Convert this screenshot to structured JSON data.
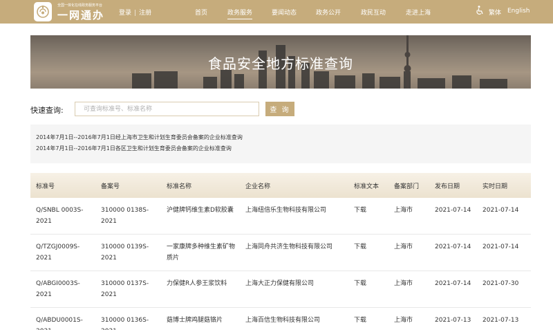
{
  "header": {
    "logo_small_text": "全国一体化在线政务服务平台",
    "logo_text": "一网通办",
    "login": "登录",
    "separator": "|",
    "register": "注册",
    "nav": [
      {
        "label": "首页",
        "active": false
      },
      {
        "label": "政务服务",
        "active": true
      },
      {
        "label": "要闻动态",
        "active": false
      },
      {
        "label": "政务公开",
        "active": false
      },
      {
        "label": "政民互动",
        "active": false
      },
      {
        "label": "走进上海",
        "active": false
      }
    ],
    "accessibility_icon": "wheelchair-icon",
    "lang_traditional": "繁体",
    "lang_english": "English",
    "bar_color": "#c6ac7c"
  },
  "banner": {
    "title": "食品安全地方标准查询"
  },
  "search": {
    "label": "快速查询:",
    "placeholder": "可查询标准号、标准名称",
    "value": "",
    "button": "查 询"
  },
  "notes": [
    "2014年7月1日--2016年7月1日经上海市卫生和计划生育委员会备案的企业标准查询",
    "2014年7月1日--2016年7月1日各区卫生和计划生育委员会备案的企业标准查询"
  ],
  "table": {
    "columns": [
      "标准号",
      "备案号",
      "标准名称",
      "企业名称",
      "标准文本",
      "备案部门",
      "发布日期",
      "实时日期"
    ],
    "rows": [
      {
        "std_no": [
          "Q/SNBL 0003S-",
          "2021"
        ],
        "record_no": [
          "310000 0138S-",
          "2021"
        ],
        "std_name": [
          "沪健牌钙维生素D软胶囊"
        ],
        "company": "上海纽倍乐生物科技有限公司",
        "text": "下载",
        "dept": "上海市",
        "publish": "2021-07-14",
        "effective": "2021-07-14"
      },
      {
        "std_no": [
          "Q/TZGJ0009S-",
          "2021"
        ],
        "record_no": [
          "310000 0139S-",
          "2021"
        ],
        "std_name": [
          "一家康牌多种维生素矿物",
          "质片"
        ],
        "company": "上海同舟共济生物科技有限公司",
        "text": "下载",
        "dept": "上海市",
        "publish": "2021-07-14",
        "effective": "2021-07-14"
      },
      {
        "std_no": [
          "Q/ABGI0003S-",
          "2021"
        ],
        "record_no": [
          "310000 0137S-",
          "2021"
        ],
        "std_name": [
          "力保健R人参王浆饮料"
        ],
        "company": "上海大正力保健有限公司",
        "text": "下载",
        "dept": "上海市",
        "publish": "2021-07-14",
        "effective": "2021-07-30"
      },
      {
        "std_no": [
          "Q/ABDU0001S-",
          "2021"
        ],
        "record_no": [
          "310000 0136S-",
          "2021"
        ],
        "std_name": [
          "菇博士牌鸡腿菇铬片"
        ],
        "company": "上海百信生物科技有限公司",
        "text": "下载",
        "dept": "上海市",
        "publish": "2021-07-13",
        "effective": "2021-07-13"
      }
    ]
  }
}
